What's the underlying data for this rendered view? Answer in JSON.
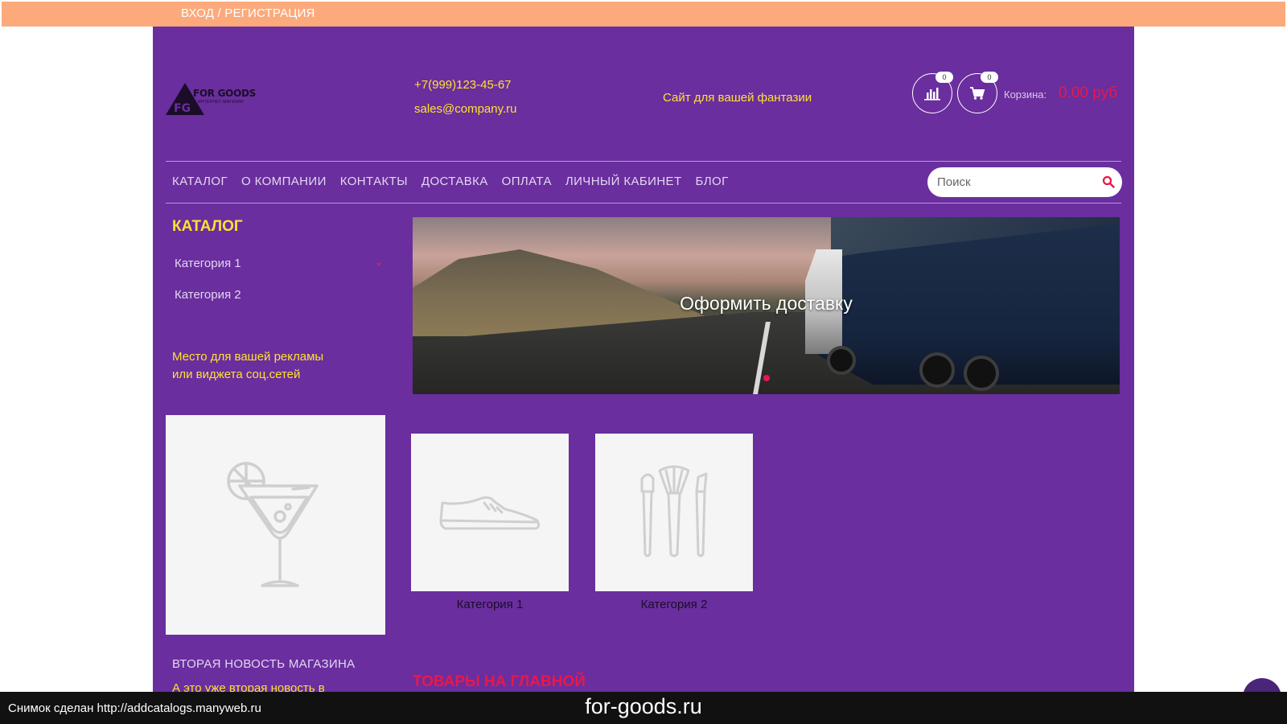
{
  "topbar": {
    "auth_link": "ВХОД / РЕГИСТРАЦИЯ"
  },
  "header": {
    "logo_name": "FOR GOODS",
    "logo_sub": "ИНТЕРНЕТ-МАГАЗИН",
    "logo_mark": "FG",
    "phone": "+7(999)123-45-67",
    "email": "sales@company.ru",
    "slogan": "Сайт для вашей фантазии",
    "compare_count": "0",
    "cart_count": "0",
    "cart_label": "Корзина:",
    "cart_total": "0.00 руб"
  },
  "nav": {
    "items": [
      "КАТАЛОГ",
      "О КОМПАНИИ",
      "КОНТАКТЫ",
      "ДОСТАВКА",
      "ОПЛАТА",
      "ЛИЧНЫЙ КАБИНЕТ",
      "БЛОГ"
    ],
    "search_placeholder": "Поиск"
  },
  "sidebar": {
    "title": "КАТАЛОГ",
    "items": [
      "Категория 1",
      "Категория 2"
    ],
    "ad_line1": "Место для вашей рекламы",
    "ad_line2": "или виджета соц.сетей",
    "news_title": "ВТОРАЯ НОВОСТЬ МАГАЗИНА",
    "news_text": "А это уже вторая новость в"
  },
  "banner": {
    "caption": "Оформить доставку"
  },
  "categories": [
    {
      "label": "Категория 1",
      "icon": "sneaker-icon"
    },
    {
      "label": "Категория 2",
      "icon": "makeup-brushes-icon"
    }
  ],
  "featured": {
    "title": "ТОВАРЫ НА ГЛАВНОЙ"
  },
  "caption_bar": {
    "left": "Снимок сделан http://addcatalogs.manyweb.ru",
    "center": "for-goods.ru"
  },
  "colors": {
    "topbar": "#fcaa7c",
    "page": "#6a2e9e",
    "accent_yellow": "#ffe033",
    "accent_red": "#e6194b"
  }
}
